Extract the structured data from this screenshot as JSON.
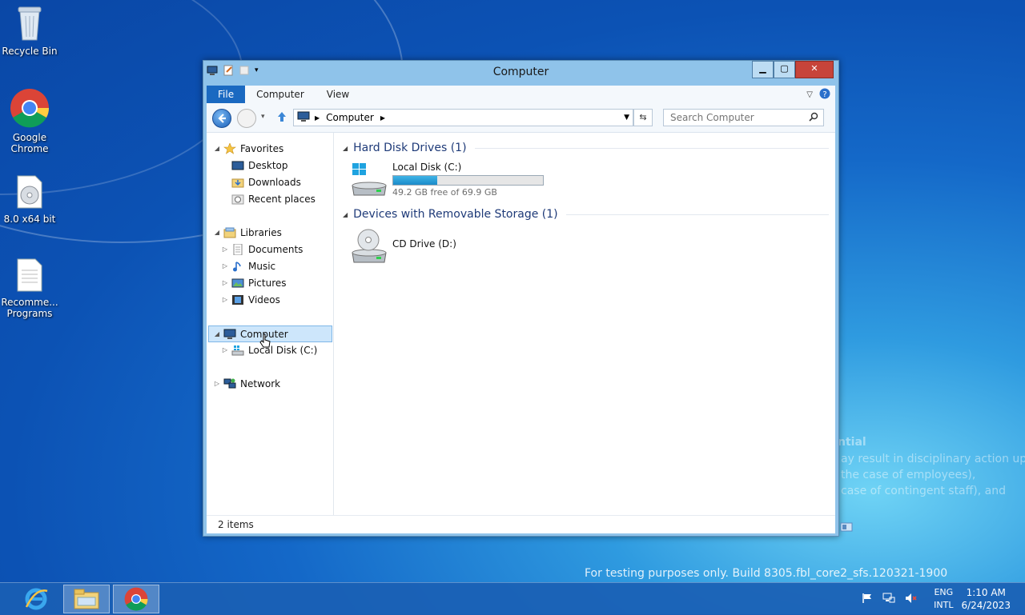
{
  "desktop": {
    "icons": [
      {
        "label": "Recycle Bin",
        "icon": "recycle-bin-icon"
      },
      {
        "label": "Google Chrome",
        "icon": "chrome-icon"
      },
      {
        "label": "8.0 x64 bit",
        "icon": "disc-file-icon"
      },
      {
        "label": "Recomme... Programs",
        "icon": "document-icon"
      }
    ],
    "build_text": "For testing purposes only. Build 8305.fbl_core2_sfs.120321-1900",
    "watermark_lines": [
      "ntial",
      "ay result in disciplinary action up",
      "the case of employees),",
      "case of contingent staff), and"
    ]
  },
  "window": {
    "title": "Computer",
    "tabs": [
      "File",
      "Computer",
      "View"
    ],
    "address": {
      "crumb": "Computer"
    },
    "search_placeholder": "Search Computer",
    "nav": {
      "favorites": "Favorites",
      "desktop": "Desktop",
      "downloads": "Downloads",
      "recent": "Recent places",
      "libraries": "Libraries",
      "documents": "Documents",
      "music": "Music",
      "pictures": "Pictures",
      "videos": "Videos",
      "computer": "Computer",
      "local_disk": "Local Disk (C:)",
      "network": "Network"
    },
    "groups": {
      "hdd": "Hard Disk Drives (1)",
      "removable": "Devices with Removable Storage (1)"
    },
    "drives": {
      "c": {
        "name": "Local Disk (C:)",
        "free": "49.2 GB free of 69.9 GB",
        "used_fraction": 0.296
      },
      "d": {
        "name": "CD Drive (D:)"
      }
    },
    "status": "2 items"
  },
  "taskbar": {
    "lang_top": "ENG",
    "lang_bottom": "INTL",
    "time": "1:10 AM",
    "date": "6/24/2023"
  },
  "colors": {
    "accent": "#1a69c1",
    "selection": "#cde6fb"
  }
}
